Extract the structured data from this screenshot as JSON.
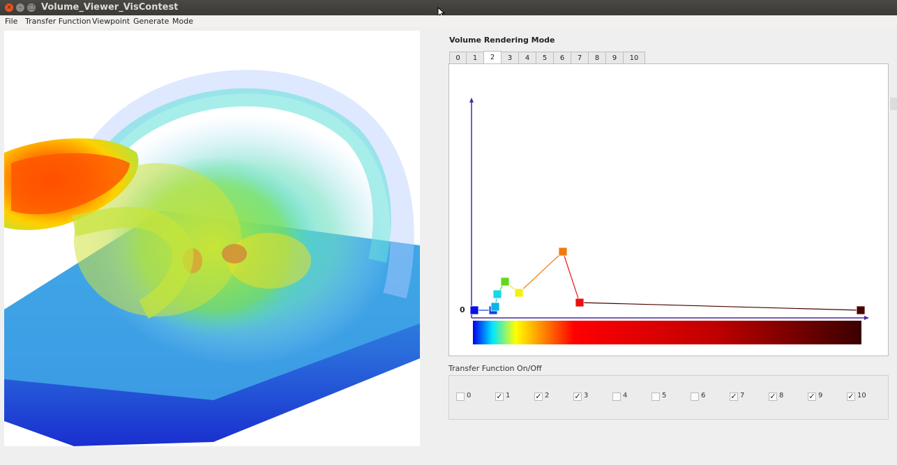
{
  "window": {
    "title": "Volume_Viewer_VisContest"
  },
  "menu": [
    "File",
    "Transfer Function",
    "Viewpoint",
    "Generate",
    "Mode"
  ],
  "rendering_mode": {
    "label": "Volume Rendering Mode",
    "tabs": [
      "0",
      "1",
      "2",
      "3",
      "4",
      "5",
      "6",
      "7",
      "8",
      "9",
      "10"
    ],
    "active_tab": "2"
  },
  "transfer_function": {
    "zero_label": "0",
    "control_points": [
      {
        "color": "#0a10e6"
      },
      {
        "color": "#1a3ee8"
      },
      {
        "color": "#0bb4e8"
      },
      {
        "color": "#18d8e6"
      },
      {
        "color": "#62d81c"
      },
      {
        "color": "#f3f010"
      },
      {
        "color": "#ee7b10"
      },
      {
        "color": "#e91010"
      },
      {
        "color": "#4a0000"
      }
    ],
    "colorbar_stops": [
      "#0000ee",
      "#00e5ff",
      "#ffff00",
      "#ff0000",
      "#c00000",
      "#3a0000"
    ]
  },
  "onoff": {
    "label": "Transfer Function On/Off",
    "items": [
      {
        "label": "0",
        "checked": false
      },
      {
        "label": "1",
        "checked": true
      },
      {
        "label": "2",
        "checked": true
      },
      {
        "label": "3",
        "checked": true
      },
      {
        "label": "4",
        "checked": false
      },
      {
        "label": "5",
        "checked": false
      },
      {
        "label": "6",
        "checked": false
      },
      {
        "label": "7",
        "checked": true
      },
      {
        "label": "8",
        "checked": true
      },
      {
        "label": "9",
        "checked": true
      },
      {
        "label": "10",
        "checked": true
      }
    ],
    "check_glyph": "✓"
  }
}
